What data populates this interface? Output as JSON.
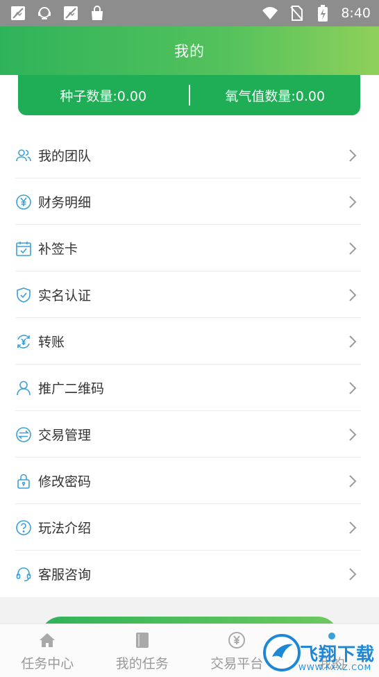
{
  "status_bar": {
    "time": "8:40",
    "left_icons": [
      "no-image-icon",
      "headset-face-icon",
      "no-image-icon",
      "shopping-bag-icon"
    ],
    "right_icons": [
      "wifi-icon",
      "no-sim-icon",
      "battery-charging-icon"
    ]
  },
  "header": {
    "title": "我的"
  },
  "balance": {
    "seeds": "种子数量:0.00",
    "oxygen": "氧气值数量:0.00"
  },
  "menu": {
    "items": [
      {
        "label": "我的团队",
        "icon": "team-icon"
      },
      {
        "label": "财务明细",
        "icon": "yen-circle-icon"
      },
      {
        "label": "补签卡",
        "icon": "calendar-check-icon"
      },
      {
        "label": "实名认证",
        "icon": "shield-check-icon"
      },
      {
        "label": "转账",
        "icon": "yen-transfer-icon"
      },
      {
        "label": "推广二维码",
        "icon": "person-icon"
      },
      {
        "label": "交易管理",
        "icon": "exchange-icon"
      },
      {
        "label": "修改密码",
        "icon": "lock-icon"
      },
      {
        "label": "玩法介绍",
        "icon": "question-circle-icon"
      },
      {
        "label": "客服咨询",
        "icon": "headset-icon"
      }
    ]
  },
  "tabs": [
    {
      "label": "任务中心",
      "icon": "home-icon"
    },
    {
      "label": "我的任务",
      "icon": "book-icon"
    },
    {
      "label": "交易平台",
      "icon": "trade-icon"
    },
    {
      "label": "我的",
      "icon": "profile-icon"
    }
  ],
  "watermark": {
    "text": "飞翔下载",
    "sub": "WWW.FXXZ.COM"
  },
  "colors": {
    "accent": "#1fad55",
    "icon_blue": "#3aa0d8",
    "header_start": "#2fb35a",
    "header_end": "#8fd05a"
  }
}
